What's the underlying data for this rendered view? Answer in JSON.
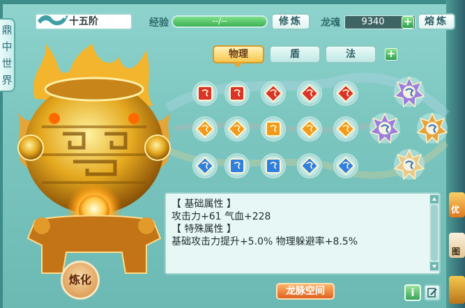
{
  "side_tab": {
    "chars": [
      "鼎",
      "中",
      "世",
      "界"
    ]
  },
  "header": {
    "rank": "十五阶",
    "exp_label": "经验",
    "exp_value": "--/--",
    "exp_progress": 1.0,
    "cultivate_button": "修炼",
    "soul_label": "龙魂",
    "soul_value": "9340",
    "smelt_button": "熔炼"
  },
  "tabs": [
    {
      "label": "物理",
      "active": true
    },
    {
      "label": "盾",
      "active": false
    },
    {
      "label": "法",
      "active": false
    }
  ],
  "gems": {
    "rows": [
      {
        "color": "red",
        "icons": [
          "square",
          "square",
          "diamond",
          "diamond",
          "diamond"
        ]
      },
      {
        "color": "orange",
        "icons": [
          "diamond",
          "diamond",
          "square",
          "diamond",
          "diamond"
        ]
      },
      {
        "color": "blue",
        "icons": [
          "diamond",
          "square",
          "square",
          "diamond",
          "diamond"
        ]
      }
    ],
    "colors": {
      "red": "#d9332a",
      "orange": "#f29a1c",
      "blue": "#2f7fe0",
      "star": "#8a6fd0"
    }
  },
  "cauldron_button": "炼化",
  "info": {
    "lines": [
      "【 基础属性 】",
      "攻击力+61 气血+228",
      "【 特殊属性 】",
      "基础攻击力提升+5.0% 物理躲避率+8.5%"
    ]
  },
  "footer": {
    "dragon_space_button": "龙脉空间",
    "info_icon": "info-icon",
    "edit_icon": "edit-icon"
  },
  "side_right": {
    "label_top": "优",
    "label_bottom": "图"
  }
}
